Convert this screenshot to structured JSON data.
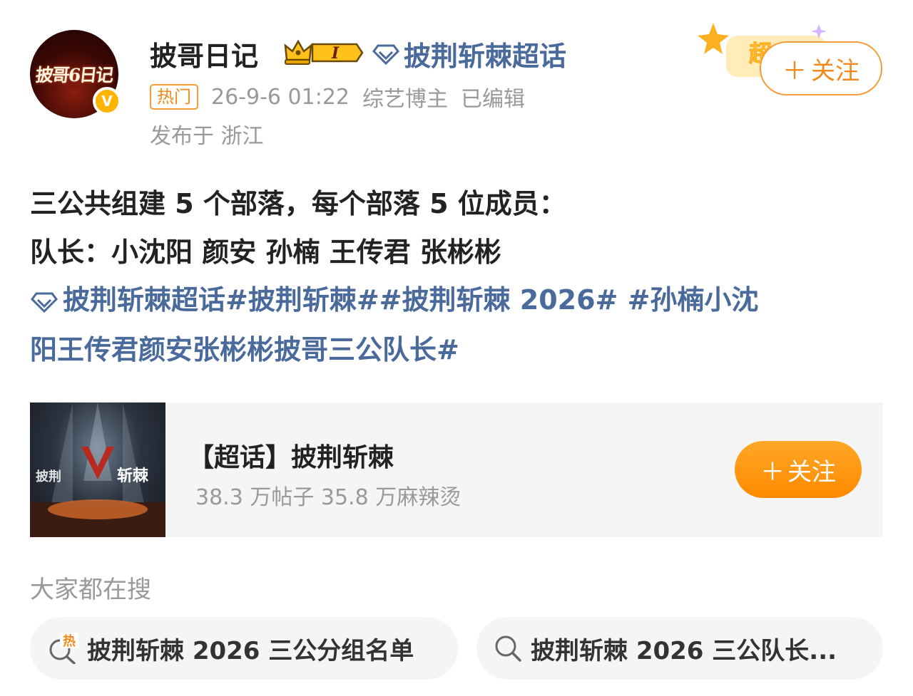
{
  "post": {
    "avatar_text": "披哥6日记",
    "username": "披哥日记",
    "badge_level": "I",
    "topic_link": "披荆斩棘超话",
    "hot_tag": "热门",
    "timestamp": "26-9-6 01:22",
    "role": "综艺博主",
    "edited": "已编辑",
    "location": "发布于 浙江",
    "super_sticker": "超",
    "follow_label": "关注",
    "body_lines": [
      "三公共组建 5 个部落，每个部落 5 位成员：",
      "队长：小沈阳  颜安 孙楠 王传君 张彬彬"
    ],
    "tags_line1": "披荆斩棘超话#披荆斩棘##披荆斩棘 2026# #孙楠小沈",
    "tags_line2": "阳王传君颜安张彬彬披哥三公队长#"
  },
  "card": {
    "cover_text": "斩棘",
    "title": "【超话】披荆斩棘",
    "subtitle": "38.3 万帖子 35.8 万麻辣烫",
    "follow_label": "关注"
  },
  "search": {
    "label": "大家都在搜",
    "hot_icon_text": "热",
    "chips": [
      "披荆斩棘 2026 三公分组名单",
      "披荆斩棘 2026 三公队长..."
    ]
  },
  "colors": {
    "link_blue": "#4a6a9c",
    "orange": "#f08a1c",
    "muted": "#999999"
  }
}
